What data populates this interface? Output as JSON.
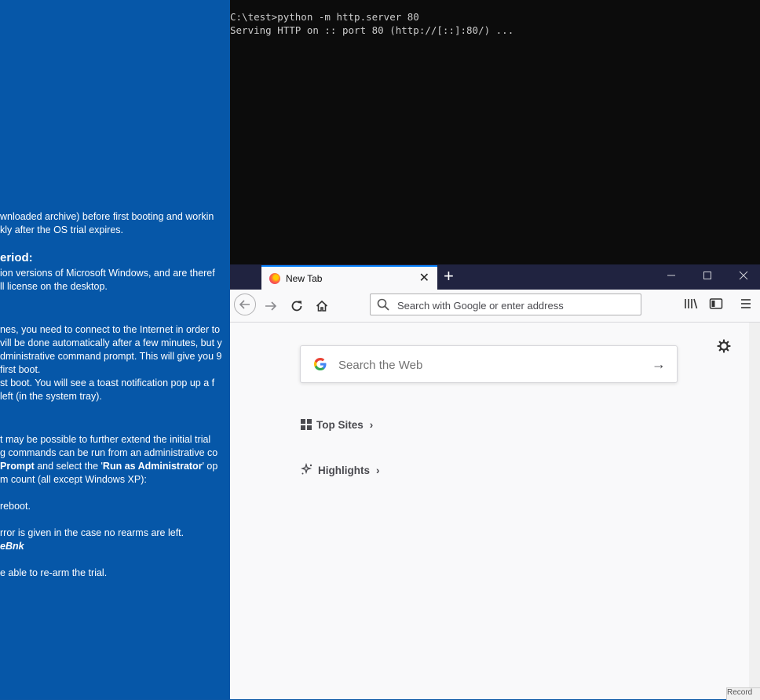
{
  "background_doc": {
    "lines": [
      "wnloaded archive) before first booting and workin",
      "kly after the OS trial expires.",
      "eriod:",
      "ion versions of Microsoft Windows, and are theref",
      "ll license on the desktop.",
      "nes, you need to connect to the Internet in order to",
      "vill be done automatically after a few minutes, but y",
      "dministrative command prompt. This will give you 9",
      "first boot.",
      "st boot. You will see a toast notification pop up a f",
      " left (in the system tray).",
      "t may be possible to further extend the initial trial",
      "g commands can be run from an administrative co",
      "Prompt",
      " and select the '",
      "Run as Administrator",
      "' op",
      "m count (all except Windows XP):",
      "reboot.",
      "rror is given in the case no rearms are left.",
      "eBnk",
      "e able to re-arm the trial."
    ]
  },
  "terminal": {
    "line1": "C:\\test>python -m http.server 80",
    "line2": "Serving HTTP on :: port 80 (http://[::]:80/) ..."
  },
  "browser": {
    "tab_title": "New Tab",
    "tab_close": "✕",
    "new_tab": "+",
    "url_placeholder": "Search with Google or enter address",
    "search_placeholder": "Search the Web",
    "top_sites_label": "Top Sites",
    "highlights_label": "Highlights",
    "accent_color": "#0a84ff",
    "titlebar_color": "#202340"
  },
  "taskbar_corner": {
    "text": "Record"
  }
}
